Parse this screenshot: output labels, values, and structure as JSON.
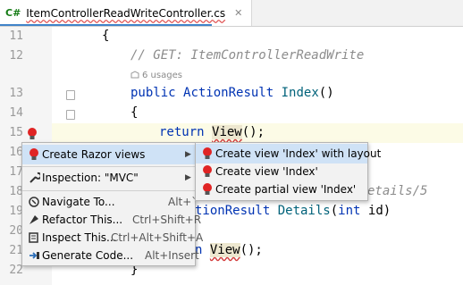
{
  "tab": {
    "lang": "C#",
    "file": "ItemControllerReadWriteController.cs",
    "close": "✕"
  },
  "lines": [
    {
      "n": "11"
    },
    {
      "n": "12"
    },
    {
      "n": "13"
    },
    {
      "n": "14"
    },
    {
      "n": "15"
    },
    {
      "n": "16"
    },
    {
      "n": "17"
    },
    {
      "n": "18"
    },
    {
      "n": "19"
    },
    {
      "n": "20"
    },
    {
      "n": "21"
    },
    {
      "n": "22"
    }
  ],
  "code": {
    "l11": "{",
    "l12": "// GET: ItemControllerReadWrite",
    "usages": "6 usages",
    "l13_kw": "public",
    "l13_type": "ActionResult",
    "l13_fn": "Index",
    "l13_rest": "()",
    "l14": "{",
    "l15_kw": "return",
    "l15_view": "View",
    "l15_rest": "();",
    "l17_frag": "etails/5",
    "l18_frag_a": "tionResult ",
    "l18_fn": "Details",
    "l18_b": "(",
    "l18_kw": "int",
    "l18_c": " id)",
    "l21_kw": "n ",
    "l21_view": "View",
    "l21_rest": "();",
    "l22": "}"
  },
  "menu": {
    "items": [
      {
        "label": "Create Razor views",
        "shortcut": "",
        "icon": "bulb-icon"
      },
      {
        "label": "Inspection: \"MVC\"",
        "shortcut": "",
        "icon": "wrench-icon"
      },
      {
        "label": "Navigate To...",
        "shortcut": "Alt+`",
        "icon": "navigate-icon"
      },
      {
        "label": "Refactor This...",
        "shortcut": "Ctrl+Shift+R",
        "icon": "refactor-icon"
      },
      {
        "label": "Inspect This...",
        "shortcut": "Ctrl+Alt+Shift+A",
        "icon": "inspect-icon"
      },
      {
        "label": "Generate Code...",
        "shortcut": "Alt+Insert",
        "icon": "generate-icon"
      }
    ]
  },
  "submenu": {
    "items": [
      {
        "label": "Create view 'Index' with layout",
        "icon": "bulb-icon"
      },
      {
        "label": "Create view 'Index'",
        "icon": "bulb-icon"
      },
      {
        "label": "Create partial view 'Index'",
        "icon": "bulb-icon"
      }
    ]
  },
  "colors": {
    "accent": "#4083c9",
    "selection": "#cfe2f6",
    "bulb": "#e02424",
    "keyword": "#0033b3",
    "highlight": "#ede7cf"
  }
}
